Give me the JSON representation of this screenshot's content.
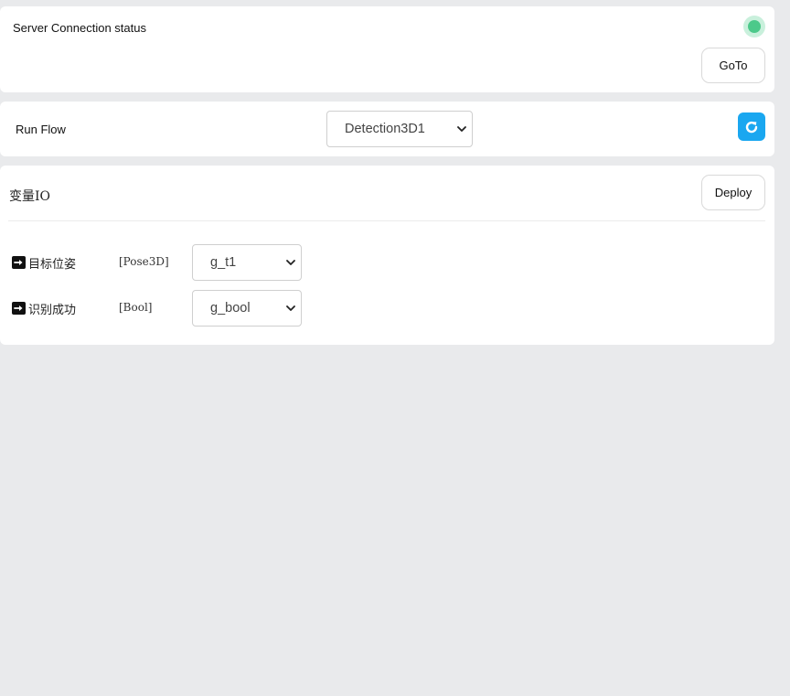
{
  "server": {
    "title": "Server Connection status",
    "status": "connected",
    "status_color": "#4cc98a",
    "goto_label": "GoTo"
  },
  "flow": {
    "label": "Run Flow",
    "selected": "Detection3D1",
    "refresh_icon": "refresh-icon",
    "refresh_color": "#1aa7f0"
  },
  "vars": {
    "title": "变量IO",
    "deploy_label": "Deploy",
    "items": [
      {
        "icon": "arrow-right-icon",
        "name": "目标位姿",
        "type": "[Pose3D]",
        "selected": "g_t1"
      },
      {
        "icon": "arrow-right-icon",
        "name": "识别成功",
        "type": "[Bool]",
        "selected": "g_bool"
      }
    ]
  }
}
